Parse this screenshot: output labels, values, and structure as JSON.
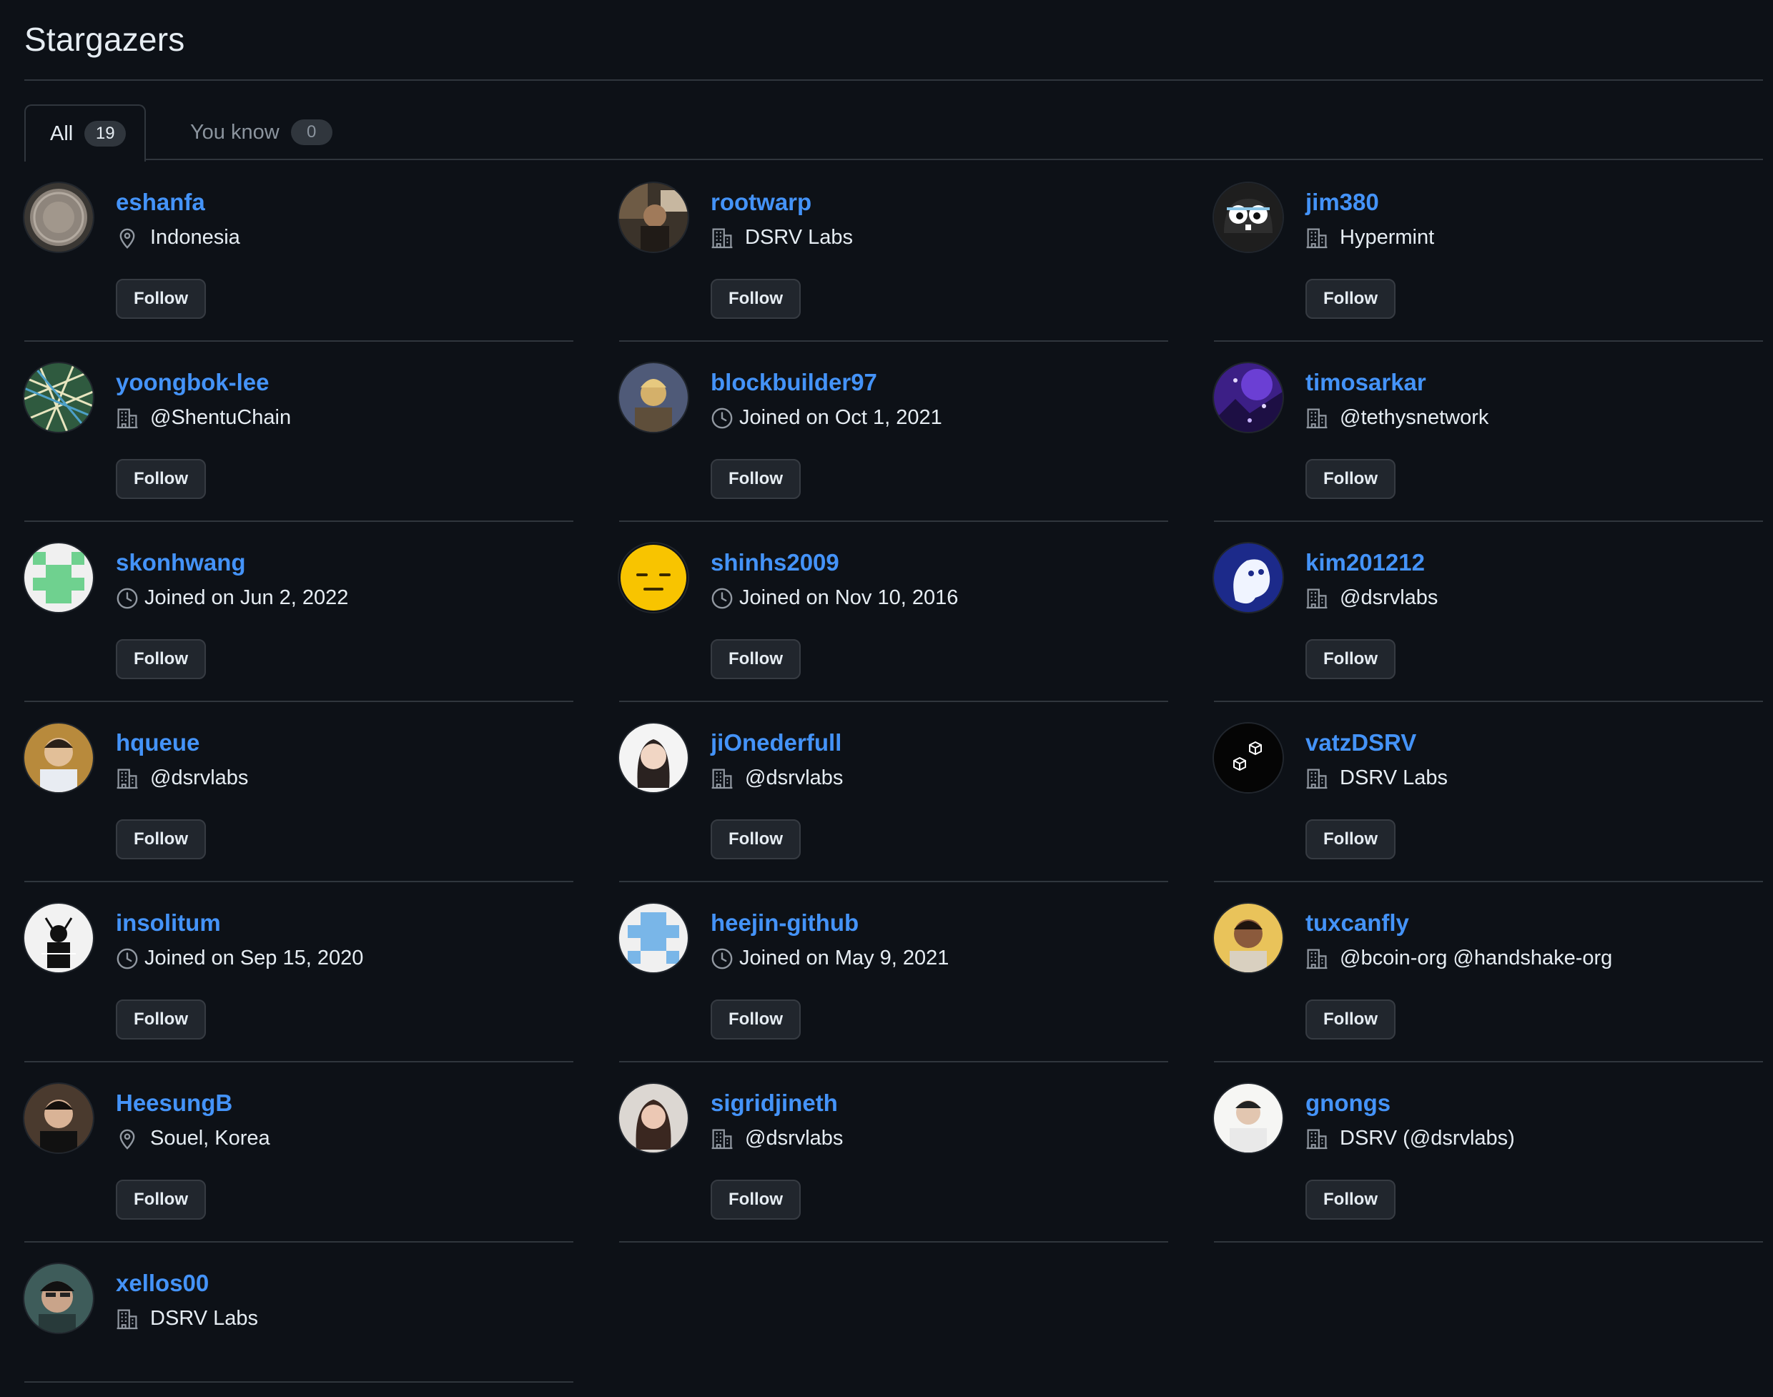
{
  "page": {
    "title": "Stargazers"
  },
  "tabs": [
    {
      "label": "All",
      "count": "19",
      "selected": true
    },
    {
      "label": "You know",
      "count": "0",
      "selected": false
    }
  ],
  "colors": {
    "background": "#0d1117",
    "link": "#4493f8",
    "border": "#30363d",
    "button_bg": "#21262d"
  },
  "users": [
    {
      "username": "eshanfa",
      "meta_icon": "location-icon",
      "meta": "Indonesia",
      "follow_label": "Follow",
      "avatar": "coin"
    },
    {
      "username": "rootwarp",
      "meta_icon": "organization-icon",
      "meta": "DSRV Labs",
      "follow_label": "Follow",
      "avatar": "photo-dark"
    },
    {
      "username": "jim380",
      "meta_icon": "organization-icon",
      "meta": "Hypermint",
      "follow_label": "Follow",
      "avatar": "gopher"
    },
    {
      "username": "yoongbok-lee",
      "meta_icon": "organization-icon",
      "meta": "@ShentuChain",
      "follow_label": "Follow",
      "avatar": "map"
    },
    {
      "username": "blockbuilder97",
      "meta_icon": "clock-icon",
      "meta": "Joined on Oct 1, 2021",
      "follow_label": "Follow",
      "avatar": "figure"
    },
    {
      "username": "timosarkar",
      "meta_icon": "organization-icon",
      "meta": "@tethysnetwork",
      "follow_label": "Follow",
      "avatar": "purple"
    },
    {
      "username": "skonhwang",
      "meta_icon": "clock-icon",
      "meta": "Joined on Jun 2, 2022",
      "follow_label": "Follow",
      "avatar": "identicon"
    },
    {
      "username": "shinhs2009",
      "meta_icon": "clock-icon",
      "meta": "Joined on Nov 10, 2016",
      "follow_label": "Follow",
      "avatar": "emoji"
    },
    {
      "username": "kim201212",
      "meta_icon": "organization-icon",
      "meta": "@dsrvlabs",
      "follow_label": "Follow",
      "avatar": "ghost"
    },
    {
      "username": "hqueue",
      "meta_icon": "organization-icon",
      "meta": "@dsrvlabs",
      "follow_label": "Follow",
      "avatar": "portrait-warm"
    },
    {
      "username": "jiOnederfull",
      "meta_icon": "organization-icon",
      "meta": "@dsrvlabs",
      "follow_label": "Follow",
      "avatar": "portrait-light"
    },
    {
      "username": "vatzDSRV",
      "meta_icon": "organization-icon",
      "meta": "DSRV Labs",
      "follow_label": "Follow",
      "avatar": "cubes"
    },
    {
      "username": "insolitum",
      "meta_icon": "clock-icon",
      "meta": "Joined on Sep 15, 2020",
      "follow_label": "Follow",
      "avatar": "sketch"
    },
    {
      "username": "heejin-github",
      "meta_icon": "clock-icon",
      "meta": "Joined on May 9, 2021",
      "follow_label": "Follow",
      "avatar": "identicon-blue"
    },
    {
      "username": "tuxcanfly",
      "meta_icon": "organization-icon",
      "meta": "@bcoin-org @handshake-org",
      "follow_label": "Follow",
      "avatar": "portrait-yellow"
    },
    {
      "username": "HeesungB",
      "meta_icon": "location-icon",
      "meta": "Souel, Korea",
      "follow_label": "Follow",
      "avatar": "portrait-dark"
    },
    {
      "username": "sigridjineth",
      "meta_icon": "organization-icon",
      "meta": "@dsrvlabs",
      "follow_label": "Follow",
      "avatar": "portrait-soft"
    },
    {
      "username": "gnongs",
      "meta_icon": "organization-icon",
      "meta": "DSRV (@dsrvlabs)",
      "follow_label": "Follow",
      "avatar": "portrait-white"
    },
    {
      "username": "xellos00",
      "meta_icon": "organization-icon",
      "meta": "DSRV Labs",
      "follow_label": "",
      "avatar": "portrait-teal"
    }
  ]
}
